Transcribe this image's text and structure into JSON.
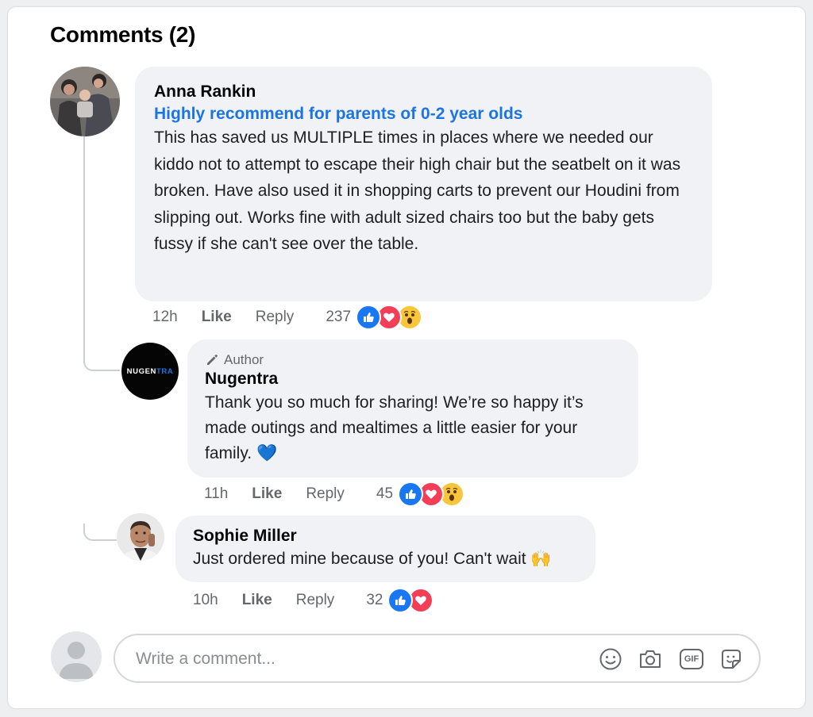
{
  "section": {
    "title": "Comments (2)"
  },
  "comments": [
    {
      "name": "Anna Rankin",
      "headline": "Highly recommend for parents of 0-2 year olds",
      "text": "This has saved us MULTIPLE times in places where we needed our kiddo not to attempt to escape their high chair but the seatbelt on it was broken. Have also used it in shopping carts to prevent our Houdini from slipping out. Works fine with adult sized chairs too but the baby gets fussy if she can't see over the table.",
      "time": "12h",
      "like_label": "Like",
      "reply_label": "Reply",
      "reaction_count": "237",
      "reactions": [
        "like",
        "love",
        "wow"
      ]
    },
    {
      "author_tag": "Author",
      "name": "Nugentra",
      "avatar_logo": "NUGENTRA",
      "text": "Thank you so much for sharing! We’re so happy it’s made outings and mealtimes a little easier for your family. 💙",
      "time": "11h",
      "like_label": "Like",
      "reply_label": "Reply",
      "reaction_count": "45",
      "reactions": [
        "like",
        "love",
        "wow"
      ]
    },
    {
      "name": "Sophie Miller",
      "text": "Just ordered mine because of you! Can't wait 🙌",
      "time": "10h",
      "like_label": "Like",
      "reply_label": "Reply",
      "reaction_count": "32",
      "reactions": [
        "like",
        "love"
      ]
    }
  ],
  "composer": {
    "placeholder": "Write a comment...",
    "icons": [
      "emoji-icon",
      "camera-icon",
      "gif-icon",
      "sticker-icon"
    ],
    "gif_label": "GIF"
  },
  "colors": {
    "link_blue": "#1b74e4",
    "like_blue": "#1877f2",
    "love_red": "#f33e58",
    "wow_yellow": "#f7c63b",
    "bubble": "#f0f2f5"
  }
}
